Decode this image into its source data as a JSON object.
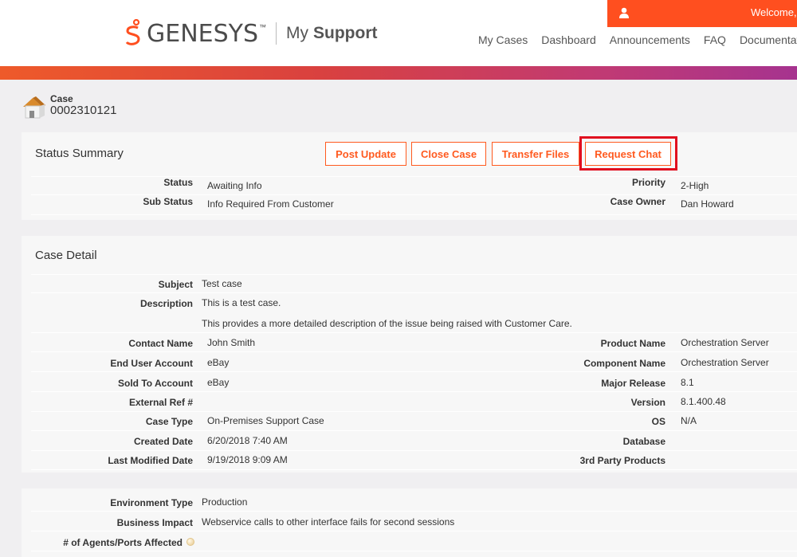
{
  "header": {
    "welcome_text": "Welcome,",
    "logo_text": "GENESYS",
    "logo_tm": "™",
    "logo_my": "My",
    "logo_support": "Support",
    "nav": [
      "My Cases",
      "Dashboard",
      "Announcements",
      "FAQ",
      "Documentat"
    ]
  },
  "case": {
    "label": "Case",
    "number": "0002310121"
  },
  "status_summary": {
    "title": "Status Summary",
    "buttons": [
      "Post Update",
      "Close Case",
      "Transfer Files",
      "Request Chat"
    ],
    "left": [
      {
        "label": "Status",
        "value": "Awaiting Info"
      },
      {
        "label": "Sub Status",
        "value": "Info Required From Customer"
      }
    ],
    "right": [
      {
        "label": "Priority",
        "value": "2-High"
      },
      {
        "label": "Case Owner",
        "value": "Dan Howard"
      }
    ]
  },
  "case_detail": {
    "title": "Case Detail",
    "subject_label": "Subject",
    "subject": "Test case",
    "description_label": "Description",
    "description_1": "This is a test case.",
    "description_2": "This provides a more detailed description of the issue being raised with Customer Care.",
    "left": [
      {
        "label": "Contact Name",
        "value": "John Smith"
      },
      {
        "label": "End User Account",
        "value": "eBay"
      },
      {
        "label": "Sold To Account",
        "value": "eBay"
      },
      {
        "label": "External Ref #",
        "value": ""
      },
      {
        "label": "Case Type",
        "value": "On-Premises Support Case"
      },
      {
        "label": "Created Date",
        "value": "6/20/2018 7:40 AM"
      },
      {
        "label": "Last Modified Date",
        "value": "9/19/2018 9:09 AM"
      }
    ],
    "right": [
      {
        "label": "Product Name",
        "value": "Orchestration Server"
      },
      {
        "label": "Component Name",
        "value": "Orchestration Server"
      },
      {
        "label": "Major Release",
        "value": "8.1"
      },
      {
        "label": "Version",
        "value": "8.1.400.48"
      },
      {
        "label": "OS",
        "value": "N/A"
      },
      {
        "label": "Database",
        "value": ""
      },
      {
        "label": "3rd Party Products",
        "value": ""
      }
    ]
  },
  "environment": {
    "rows": [
      {
        "label": "Environment Type",
        "value": "Production"
      },
      {
        "label": "Business Impact",
        "value": "Webservice calls to other interface fails for second sessions"
      },
      {
        "label": "# of Agents/Ports Affected",
        "value": ""
      }
    ]
  },
  "colors": {
    "accent": "#ff5a1f",
    "highlight": "#e10f1f"
  }
}
